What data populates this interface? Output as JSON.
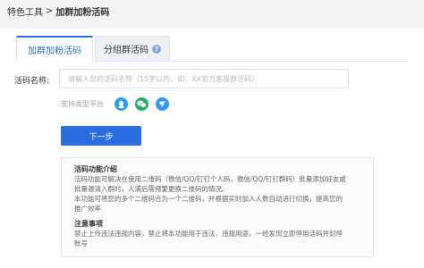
{
  "breadcrumb": {
    "parent": "特色工具",
    "separator": ">",
    "current": "加群加粉活码"
  },
  "tabs": [
    {
      "label": "加群加粉活码",
      "active": true
    },
    {
      "label": "分组群活码",
      "help_icon": "?"
    }
  ],
  "form": {
    "name_label": "活码名称:",
    "name_placeholder": "请输入您的活码名称（15字以内，如：XX官方客服群活码）",
    "platform_label": "支持类型平台",
    "platforms": [
      "qq-icon",
      "wechat-icon",
      "dingtalk-icon"
    ],
    "next_button": "下一步"
  },
  "info": {
    "intro_title": "活码功能介绍",
    "intro_lines": [
      "活码功能可解决在使用二维码（微信/QQ/钉钉个人码，微信/QQ/钉钉群码）批量添加好友或",
      "批量邀请入群时，人满后需频繁更换二维码的情况。",
      "本功能可将您的多个二维码合为一个二维码，并根据实时加入人数自动进行切换，提高您的",
      "推广效率"
    ],
    "notice_title": "注意事项",
    "notice_lines": [
      "禁止上传违法违规内容，禁止将本功能用于违法、违规用途，一经发现立即停用活码并封停",
      "账号"
    ]
  },
  "colors": {
    "accent": "#2b6de0",
    "qq": "#2a9df4",
    "wechat": "#2aae67",
    "dingtalk": "#3296fa"
  }
}
